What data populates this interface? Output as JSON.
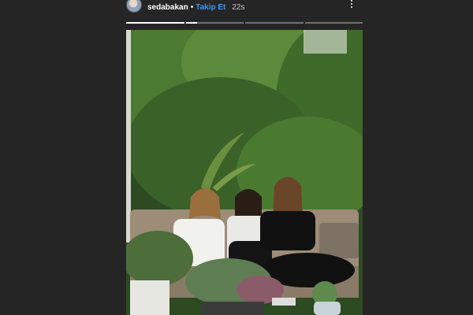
{
  "story": {
    "username": "sedabakan",
    "separator": "•",
    "follow_label": "Takip Et",
    "timestamp": "22s",
    "progress": [
      1,
      0.2,
      0,
      0
    ],
    "photo_alt": "",
    "icons": {
      "avatar": "user-avatar",
      "more": "more-options-icon"
    }
  },
  "colors": {
    "background": "#252525",
    "follow": "#3897f0",
    "text": "#ffffff"
  }
}
